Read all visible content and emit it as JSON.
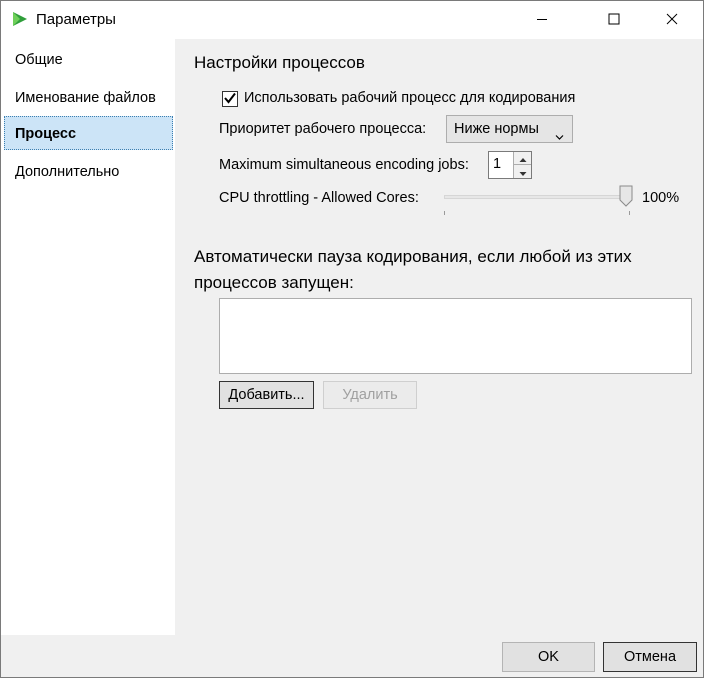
{
  "window": {
    "title": "Параметры"
  },
  "sidebar": {
    "items": [
      {
        "label": "Общие"
      },
      {
        "label": "Именование файлов"
      },
      {
        "label": "Процесс"
      },
      {
        "label": "Дополнительно"
      }
    ],
    "selected_index": 2
  },
  "process": {
    "section_title": "Настройки процессов",
    "use_worker_label": "Использовать рабочий процесс для кодирования",
    "use_worker_checked": true,
    "priority_label": "Приоритет рабочего процесса:",
    "priority_value": "Ниже нормы",
    "jobs_label": "Maximum simultaneous encoding jobs:",
    "jobs_value": "1",
    "cpu_label": "CPU throttling - Allowed Cores:",
    "cpu_percent_text": "100%",
    "cpu_percent": 100
  },
  "auto_pause": {
    "title": "Автоматически пауза кодирования, если любой из этих процессов запущен:",
    "processes": [],
    "add_button": "Добавить...",
    "remove_button": "Удалить"
  },
  "footer": {
    "ok_button": "OK",
    "cancel_button": "Отмена"
  },
  "colors": {
    "selection_bg": "#cce4f7",
    "panel_bg": "#f0f0f0",
    "app_icon_green": "#3aa53a"
  },
  "icons": {
    "app": "handbrake-logo-icon",
    "minimize": "minimize-icon",
    "maximize": "maximize-icon",
    "close": "close-icon"
  }
}
